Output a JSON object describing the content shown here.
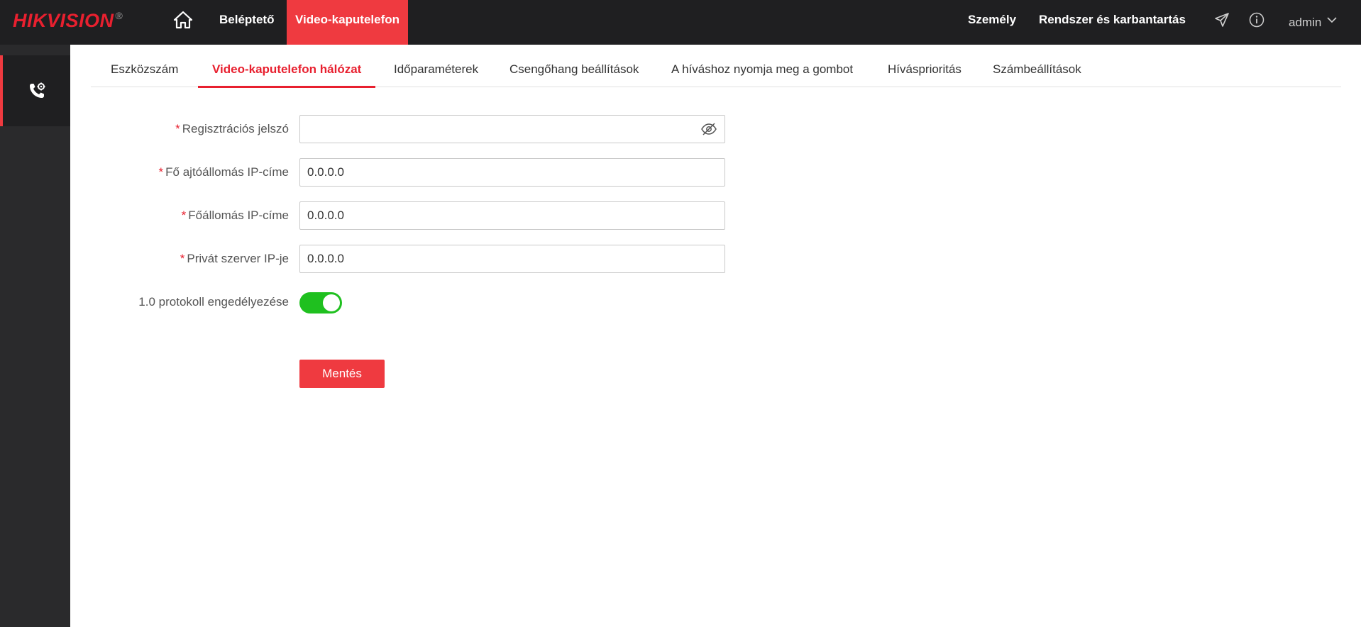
{
  "header": {
    "logo_text": "HIKVISION",
    "logo_mark": "®",
    "home_icon": "home-icon",
    "nav": [
      {
        "label": "Beléptető",
        "active": false
      },
      {
        "label": "Video-kaputelefon",
        "active": true
      }
    ],
    "right_nav": [
      {
        "label": "Személy"
      },
      {
        "label": "Rendszer és karbantartás"
      }
    ],
    "icons": [
      "send-icon",
      "info-icon"
    ],
    "user": "admin"
  },
  "sidebar": {
    "items": [
      {
        "icon": "phone-settings-icon",
        "active": true
      }
    ]
  },
  "tabs": [
    {
      "label": "Eszközszám",
      "active": false
    },
    {
      "label": "Video-kaputelefon hálózat",
      "active": true
    },
    {
      "label": "Időparaméterek",
      "active": false
    },
    {
      "label": "Csengőhang beállítások",
      "active": false
    },
    {
      "label": "A híváshoz nyomja meg a gombot",
      "active": false
    },
    {
      "label": "Hívásprioritás",
      "active": false
    },
    {
      "label": "Számbeállítások",
      "active": false
    }
  ],
  "form": {
    "registration_password": {
      "label": "Regisztrációs jelszó",
      "required": true,
      "value": ""
    },
    "main_door_station_ip": {
      "label": "Fő ajtóállomás IP-címe",
      "required": true,
      "value": "0.0.0.0"
    },
    "main_station_ip": {
      "label": "Főállomás IP-címe",
      "required": true,
      "value": "0.0.0.0"
    },
    "private_server_ip": {
      "label": "Privát szerver IP-je",
      "required": true,
      "value": "0.0.0.0"
    },
    "protocol_1_0": {
      "label": "1.0 protokoll engedélyezése",
      "enabled": true
    },
    "save_label": "Mentés",
    "required_mark": "*"
  },
  "colors": {
    "accent": "#ef3a40",
    "topbar": "#1f1f21",
    "sidebar": "#2a2a2c",
    "toggle_on": "#1fc01f"
  }
}
